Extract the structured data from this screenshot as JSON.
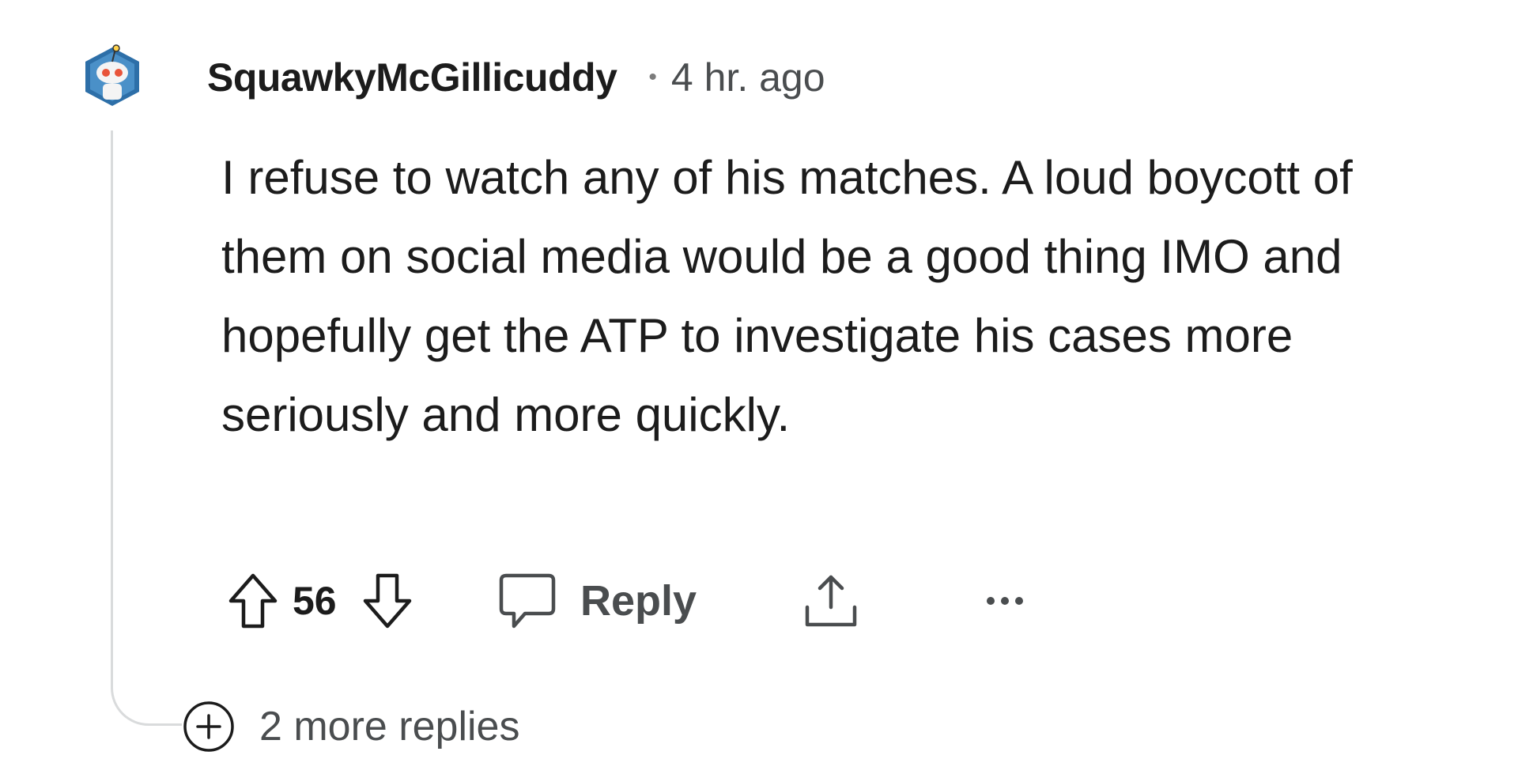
{
  "comment": {
    "author": "SquawkyMcGillicuddy",
    "separator": "•",
    "timestamp": "4 hr. ago",
    "body": "I refuse to watch any of his matches. A loud boycott of them on social media would be a good thing IMO and hopefully get the ATP to investigate his cases more seriously and more quickly.",
    "score": "56",
    "reply_label": "Reply",
    "more_replies_label": "2 more replies"
  },
  "icons": {
    "avatar": "snoo-avatar",
    "upvote": "arrow-up-icon",
    "downvote": "arrow-down-icon",
    "reply": "speech-bubble-icon",
    "share": "share-icon",
    "more": "ellipsis-icon",
    "expand": "plus-circle-icon"
  },
  "colors": {
    "text": "#1c1c1c",
    "secondary": "#4a4d4f",
    "thread_line": "#d9dbdc",
    "avatar_bg": "#2d6fa8"
  }
}
